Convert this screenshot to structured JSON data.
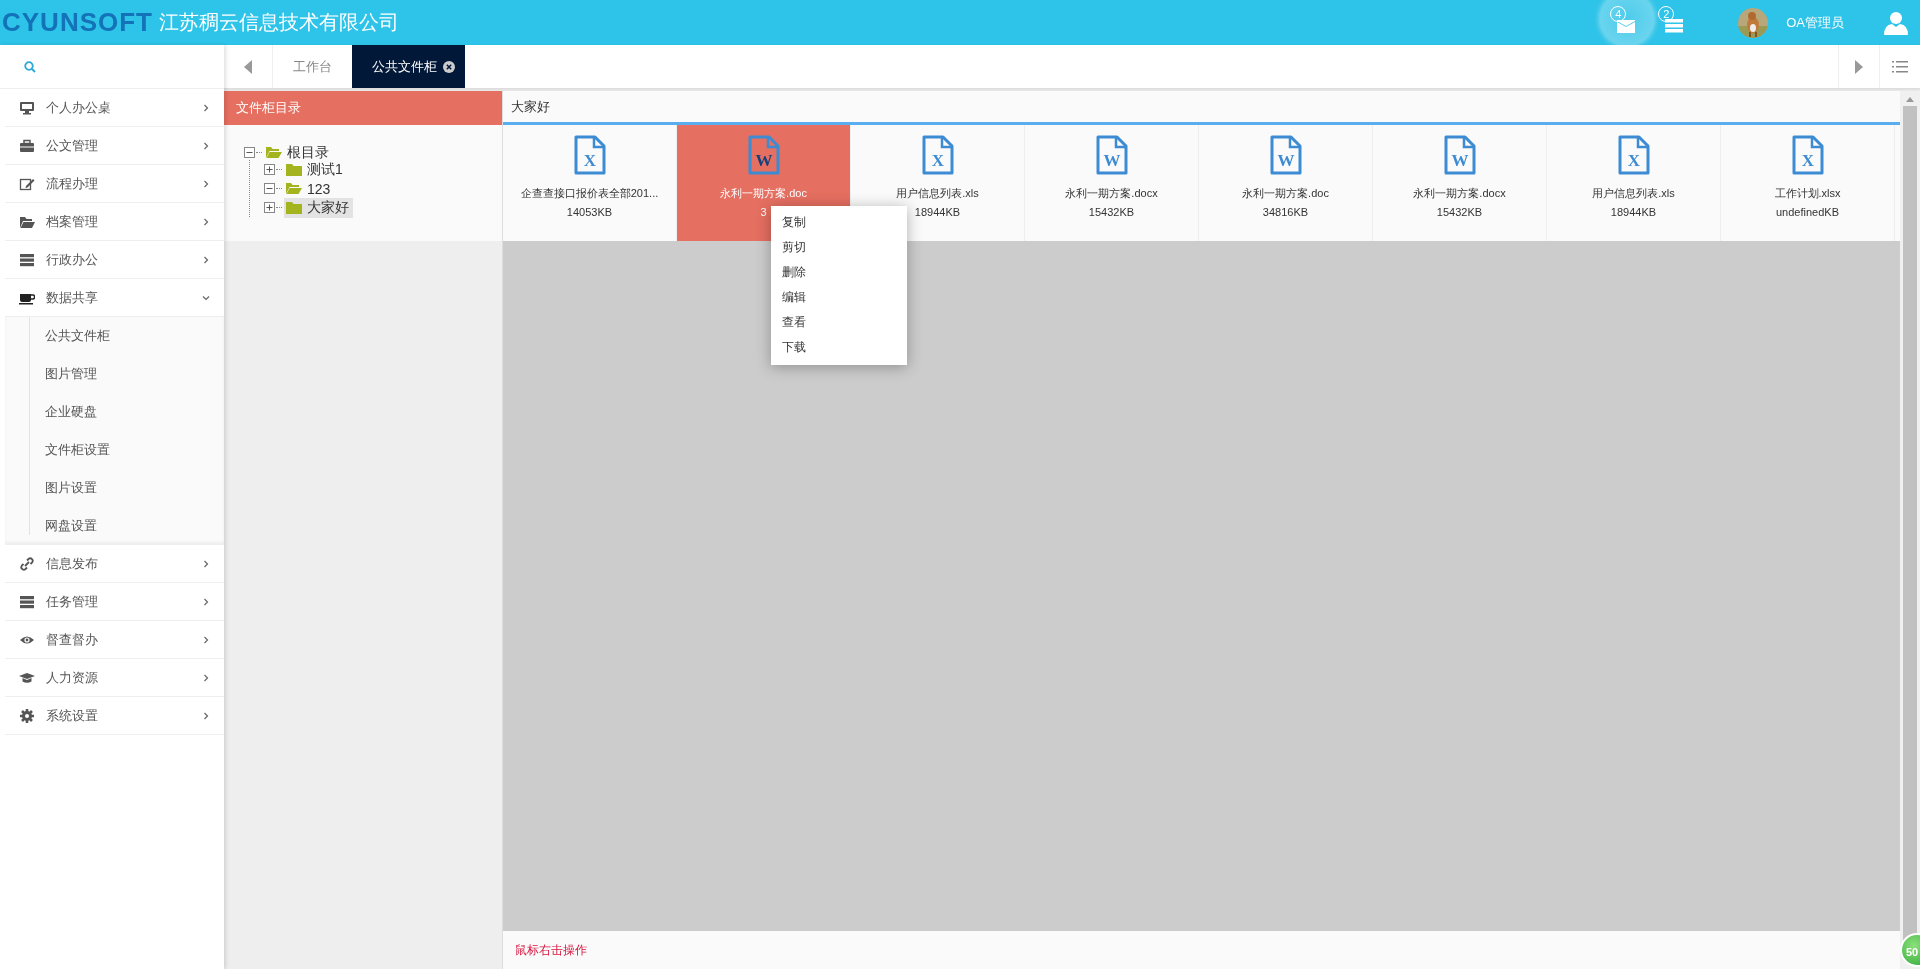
{
  "header": {
    "logo": "CYUNSOFT",
    "company": "江苏稠云信息技术有限公司",
    "notifications": [
      {
        "kind": "mail",
        "count": "4",
        "highlighted": true
      },
      {
        "kind": "tasks",
        "count": "2",
        "highlighted": false
      }
    ],
    "user": "OA管理员"
  },
  "sidebar": {
    "items": [
      {
        "kind": "desktop",
        "label": "个人办公桌",
        "expanded": false
      },
      {
        "kind": "briefcase",
        "label": "公文管理",
        "expanded": false
      },
      {
        "kind": "edit",
        "label": "流程办理",
        "expanded": false
      },
      {
        "kind": "folder",
        "label": "档案管理",
        "expanded": false
      },
      {
        "kind": "server",
        "label": "行政办公",
        "expanded": false
      },
      {
        "kind": "cup",
        "label": "数据共享",
        "expanded": true,
        "children": [
          {
            "label": "公共文件柜"
          },
          {
            "label": "图片管理"
          },
          {
            "label": "企业硬盘"
          },
          {
            "label": "文件柜设置"
          },
          {
            "label": "图片设置"
          },
          {
            "label": "网盘设置"
          }
        ]
      },
      {
        "kind": "link",
        "label": "信息发布",
        "expanded": false
      },
      {
        "kind": "server",
        "label": "任务管理",
        "expanded": false
      },
      {
        "kind": "eye",
        "label": "督查督办",
        "expanded": false
      },
      {
        "kind": "cap",
        "label": "人力资源",
        "expanded": false
      },
      {
        "kind": "gear",
        "label": "系统设置",
        "expanded": false
      }
    ]
  },
  "tabs": [
    {
      "label": "工作台",
      "selected": false,
      "closable": false
    },
    {
      "label": "公共文件柜",
      "selected": true,
      "closable": true
    }
  ],
  "tree_panel": {
    "title": "文件柜目录",
    "tree": [
      {
        "label": "根目录",
        "expanded": true,
        "selected": false,
        "children": [
          {
            "label": "测试1",
            "expanded": false,
            "selected": false
          },
          {
            "label": "123",
            "expanded": true,
            "selected": false
          },
          {
            "label": "大家好",
            "expanded": false,
            "selected": true
          }
        ]
      }
    ]
  },
  "file_panel": {
    "title": "大家好",
    "files": [
      {
        "glyph": "X",
        "name": "企查查接口报价表全部201...",
        "size": "14053KB",
        "selected": false
      },
      {
        "glyph": "W",
        "name": "永利一期方案.doc",
        "size": "3",
        "selected": true
      },
      {
        "glyph": "X",
        "name": "用户信息列表.xls",
        "size": "18944KB",
        "selected": false
      },
      {
        "glyph": "W",
        "name": "永利一期方案.docx",
        "size": "15432KB",
        "selected": false
      },
      {
        "glyph": "W",
        "name": "永利一期方案.doc",
        "size": "34816KB",
        "selected": false
      },
      {
        "glyph": "W",
        "name": "永利一期方案.docx",
        "size": "15432KB",
        "selected": false
      },
      {
        "glyph": "X",
        "name": "用户信息列表.xls",
        "size": "18944KB",
        "selected": false
      },
      {
        "glyph": "X",
        "name": "工作计划.xlsx",
        "size": "undefinedKB",
        "selected": false
      }
    ],
    "status": "鼠标右击操作"
  },
  "context_menu": {
    "items": [
      "复制",
      "剪切",
      "删除",
      "编辑",
      "查看",
      "下载"
    ]
  },
  "corner_badge": "50"
}
